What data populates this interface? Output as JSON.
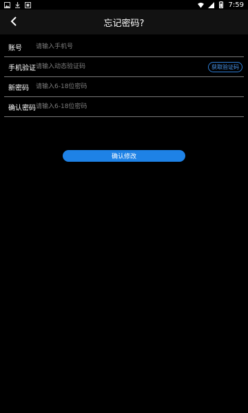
{
  "status_bar": {
    "time": "7:59",
    "left_icons": [
      "image-icon",
      "download-icon",
      "app-icon"
    ],
    "right_icons": [
      "wifi-icon",
      "signal-icon",
      "battery-icon"
    ]
  },
  "header": {
    "title": "忘记密码?",
    "back_icon": "chevron-left-icon"
  },
  "form": {
    "account": {
      "label": "账号",
      "placeholder": "请输入手机号",
      "value": ""
    },
    "verify": {
      "label": "手机验证",
      "placeholder": "请输入动态验证码",
      "value": "",
      "get_code_label": "获取验证码"
    },
    "new_password": {
      "label": "新密码",
      "placeholder": "请输入6-18位密码",
      "value": ""
    },
    "confirm_password": {
      "label": "确认密码",
      "placeholder": "请输入6-18位密码",
      "value": ""
    }
  },
  "submit": {
    "label": "确认修改"
  },
  "colors": {
    "background": "#000000",
    "appbar": "#121212",
    "accent": "#1e82e6",
    "divider": "#7a7a7a",
    "placeholder": "#7d7d7d"
  }
}
